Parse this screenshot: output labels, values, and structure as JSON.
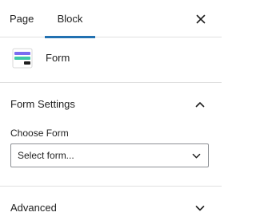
{
  "tabs": [
    {
      "label": "Page",
      "active": false
    },
    {
      "label": "Block",
      "active": true
    }
  ],
  "close_icon": "close-icon",
  "block": {
    "title": "Form",
    "icon": "form-block-icon",
    "icon_colors": [
      "#7b6cf0",
      "#3ec7a8",
      "#1e1e1e"
    ]
  },
  "form_settings": {
    "title": "Form Settings",
    "expanded": true,
    "choose_form_label": "Choose Form",
    "select": {
      "value": "Select form..."
    }
  },
  "advanced": {
    "title": "Advanced",
    "expanded": false
  },
  "colors": {
    "accent": "#2271b1",
    "border": "#e0e0e0",
    "text": "#1e1e1e"
  }
}
